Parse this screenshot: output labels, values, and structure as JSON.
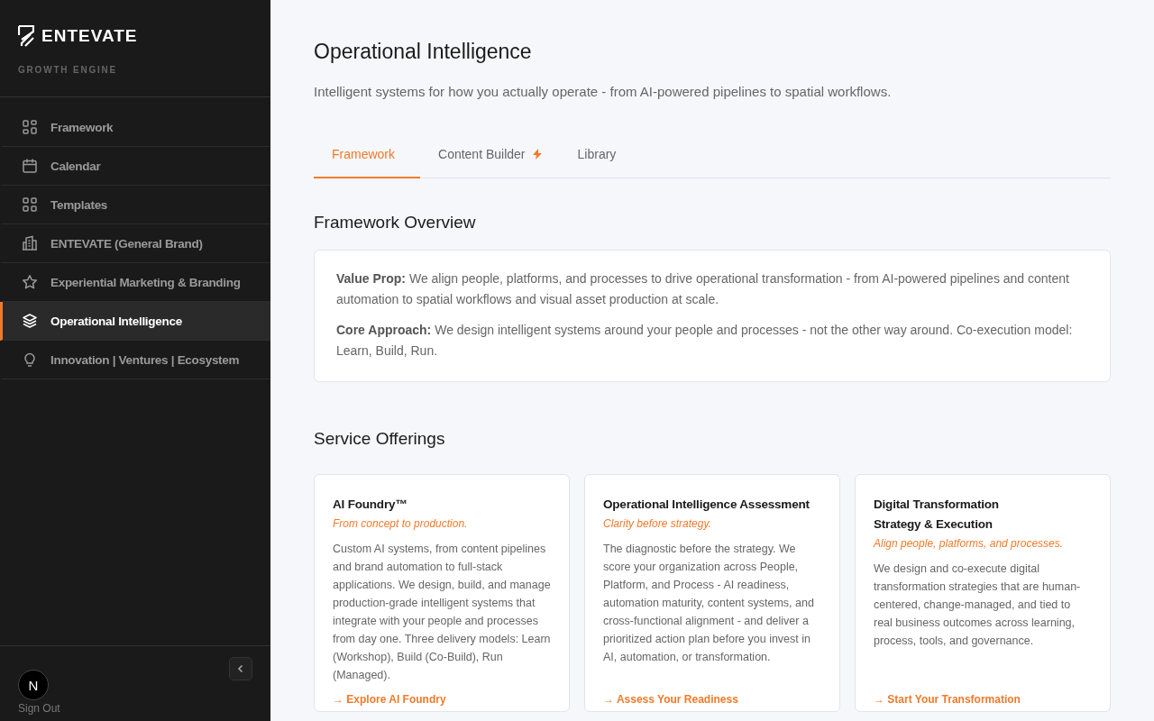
{
  "brand": {
    "name": "ENTEVATE",
    "tagline": "GROWTH ENGINE"
  },
  "nav": [
    {
      "label": "Framework",
      "selected": false
    },
    {
      "label": "Calendar",
      "selected": false
    },
    {
      "label": "Templates",
      "selected": false
    },
    {
      "label": "ENTEVATE (General Brand)",
      "selected": false
    },
    {
      "label": "Experiential Marketing & Branding",
      "selected": false
    },
    {
      "label": "Operational Intelligence",
      "selected": true
    },
    {
      "label": "Innovation | Ventures | Ecosystem",
      "selected": false
    }
  ],
  "sidebar_footer": {
    "avatar": "N",
    "sign_out": "Sign Out"
  },
  "page": {
    "title": "Operational Intelligence",
    "subtitle": "Intelligent systems for how you actually operate - from AI-powered pipelines to spatial workflows."
  },
  "tabs": [
    {
      "label": "Framework",
      "selected": true,
      "badge": false
    },
    {
      "label": "Content Builder",
      "selected": false,
      "badge": true
    },
    {
      "label": "Library",
      "selected": false,
      "badge": false
    }
  ],
  "overview": {
    "heading": "Framework Overview",
    "paragraphs": [
      "**Value Prop:** We align people, platforms, and processes to drive operational transformation - from AI-powered pipelines and content automation to spatial workflows and visual asset production at scale.",
      "**Core Approach:** We design intelligent systems around your people and processes - not the other way around. Co-execution model: Learn, Build, Run."
    ]
  },
  "services": {
    "heading": "Service Offerings",
    "cards": [
      {
        "title": "AI Foundry™",
        "tagline": "From concept to production.",
        "body": "Custom AI systems, from content pipelines and brand automation to full-stack applications. We design, build, and manage production-grade intelligent systems that integrate with your people and processes from day one. Three delivery models: Learn (Workshop), Build (Co-Build), Run (Managed).",
        "link": "→ Explore AI Foundry"
      },
      {
        "title": "Operational Intelligence Assessment",
        "tagline": "Clarity before strategy.",
        "body": "The diagnostic before the strategy. We score your organization across People, Platform, and Process - AI readiness, automation maturity, content systems, and cross-functional alignment - and deliver a prioritized action plan before you invest in AI, automation, or transformation.",
        "link": "→ Assess Your Readiness"
      },
      {
        "title": "Digital Transformation Strategy & Execution",
        "tagline": "Align people, platforms, and processes.",
        "body": "We design and co-execute digital transformation strategies that are human-centered, change-managed, and tied to real business outcomes across learning, process, tools, and governance.",
        "link": "→ Start Your Transformation"
      }
    ]
  }
}
